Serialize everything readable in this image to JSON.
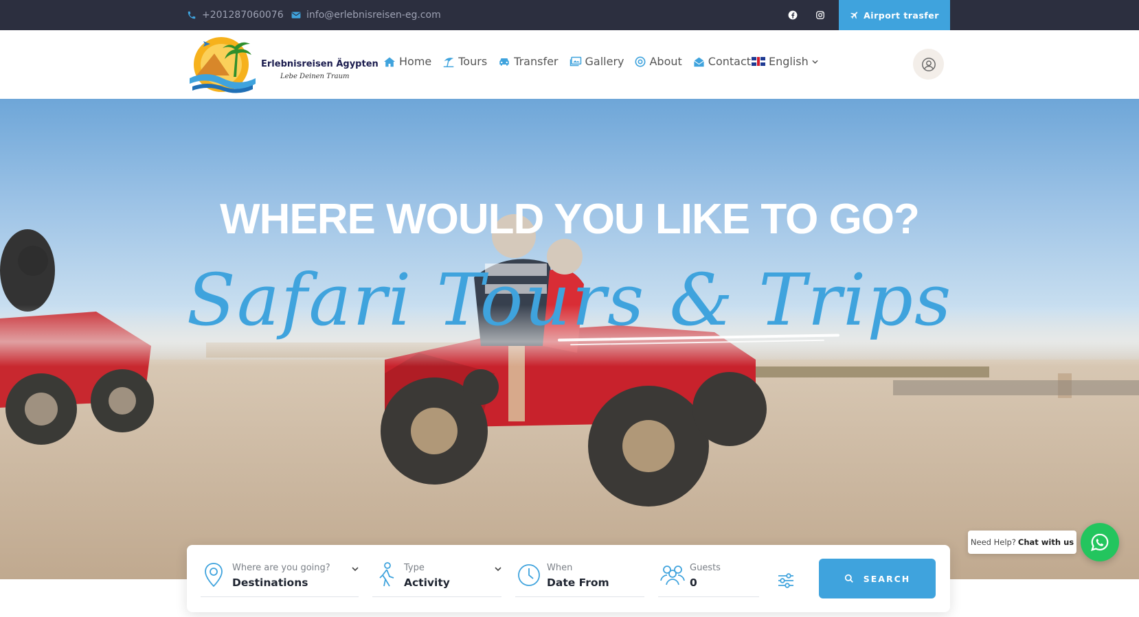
{
  "topbar": {
    "phone": "+201287060076",
    "email": "info@erlebnisreisen-eg.com",
    "airport_button": "Airport trasfer",
    "social_icons": [
      "facebook-icon",
      "instagram-icon"
    ]
  },
  "header": {
    "logo_brand": "Erlebnisreisen Ägypten",
    "logo_tagline": "Lebe Deinen Traum",
    "nav": [
      {
        "label": "Home",
        "icon": "home-icon"
      },
      {
        "label": "Tours",
        "icon": "umbrella-icon"
      },
      {
        "label": "Transfer",
        "icon": "car-icon"
      },
      {
        "label": "Gallery",
        "icon": "gallery-icon"
      },
      {
        "label": "About",
        "icon": "info-circle-icon"
      },
      {
        "label": "Contact",
        "icon": "envelope-icon"
      }
    ],
    "language": "English"
  },
  "hero": {
    "title": "WHERE WOULD YOU LIKE TO GO?",
    "script": "Safari Tours & Trips"
  },
  "search": {
    "destination": {
      "label": "Where are you going?",
      "value": "Destinations"
    },
    "type": {
      "label": "Type",
      "value": "Activity"
    },
    "when": {
      "label": "When",
      "value": "Date From"
    },
    "guests": {
      "label": "Guests",
      "value": "0"
    },
    "button": "SEARCH"
  },
  "whatsapp": {
    "need_help": "Need Help?",
    "chat": "Chat with us"
  },
  "colors": {
    "accent": "#3fa3dd",
    "topbar": "#2c2f3f",
    "whatsapp": "#23c55e"
  }
}
